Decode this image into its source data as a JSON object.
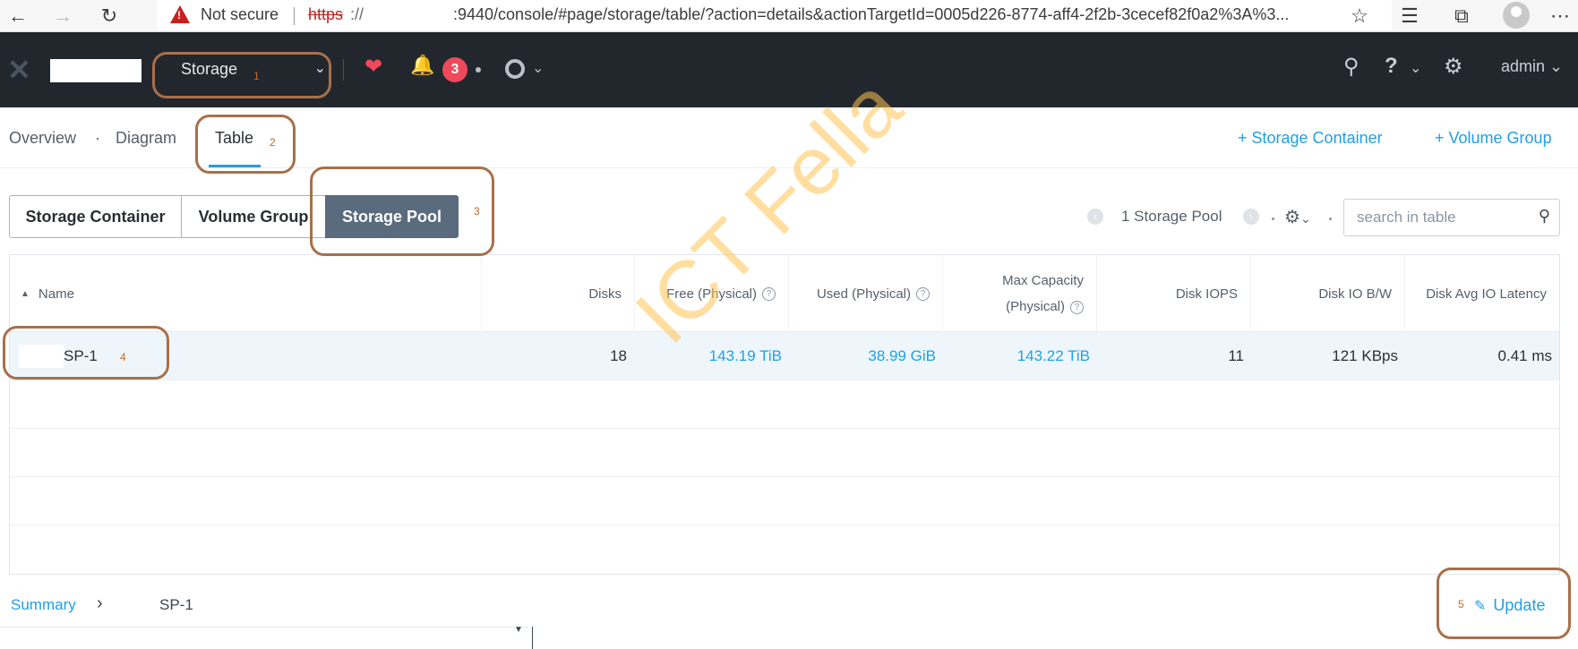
{
  "browser": {
    "back_icon": "arrow-left-icon",
    "forward_icon": "arrow-right-icon",
    "reload_icon": "reload-icon",
    "security_label": "Not secure",
    "url_scheme": "https",
    "url_slashes": "://",
    "url_rest": ":9440/console/#page/storage/table/?action=details&actionTargetId=0005d226-8774-aff4-2f2b-3cecef82f0a2%3A%3...",
    "toolbar_icons": [
      "favorite-add-icon",
      "favorites-icon",
      "collections-icon",
      "profile-avatar-icon",
      "more-icon"
    ]
  },
  "header": {
    "logo_icon": "nutanix-x-icon",
    "section_label": "Storage",
    "health_icon": "heart-pulse-icon",
    "alert_count": "3",
    "user_label": "admin",
    "accent_alert": "#f0495b"
  },
  "subnav": {
    "tabs": [
      {
        "label": "Overview"
      },
      {
        "label": "Diagram"
      },
      {
        "label": "Table"
      }
    ],
    "actions": [
      {
        "label": "+ Storage Container"
      },
      {
        "label": "+ Volume Group"
      }
    ],
    "separator": "·"
  },
  "segments": [
    {
      "label": "Storage Container"
    },
    {
      "label": "Volume Group"
    },
    {
      "label": "Storage Pool",
      "selected": true
    }
  ],
  "tools": {
    "count_label": "1 Storage Pool",
    "search_placeholder": "search in table"
  },
  "table": {
    "sort_indicator": "▲",
    "columns": [
      {
        "label": "Name"
      },
      {
        "label": "Disks"
      },
      {
        "label": "Free (Physical)"
      },
      {
        "label": "Used (Physical)"
      },
      {
        "label": "Max Capacity (Physical)",
        "line1": "Max Capacity",
        "line2": "(Physical)"
      },
      {
        "label": "Disk IOPS"
      },
      {
        "label": "Disk IO B/W"
      },
      {
        "label": "Disk Avg IO Latency"
      }
    ],
    "rows": [
      {
        "name": "SP-1",
        "disks": "18",
        "free": "143.19 TiB",
        "used": "38.99 GiB",
        "max": "143.22 TiB",
        "iops": "11",
        "bw": "121 KBps",
        "latency": "0.41 ms"
      }
    ]
  },
  "bottom": {
    "summary_label": "Summary",
    "chevron": "›",
    "selected_name": "SP-1",
    "update_label": "Update"
  },
  "annotations": {
    "numbers": [
      "1",
      "2",
      "3",
      "4",
      "5"
    ],
    "watermark": "ICT Fella"
  },
  "colors": {
    "link": "#1fa0e6",
    "header_bg": "#22272e",
    "selected_segment": "#5b6b7e",
    "annotation": "#a8704a"
  }
}
